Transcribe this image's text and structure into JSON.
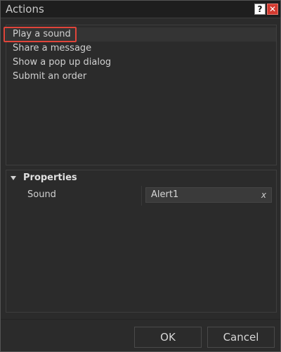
{
  "window": {
    "title": "Actions",
    "help_glyph": "?",
    "close_glyph": "✕"
  },
  "actions": {
    "items": [
      {
        "label": "Play a sound",
        "selected": true
      },
      {
        "label": "Share a message",
        "selected": false
      },
      {
        "label": "Show a pop up dialog",
        "selected": false
      },
      {
        "label": "Submit an order",
        "selected": false
      }
    ]
  },
  "properties": {
    "title": "Properties",
    "rows": [
      {
        "label": "Sound",
        "value": "Alert1",
        "clear_glyph": "x"
      }
    ]
  },
  "footer": {
    "ok_label": "OK",
    "cancel_label": "Cancel"
  },
  "colors": {
    "highlight": "#e0453a",
    "close_button": "#d43a2f"
  }
}
